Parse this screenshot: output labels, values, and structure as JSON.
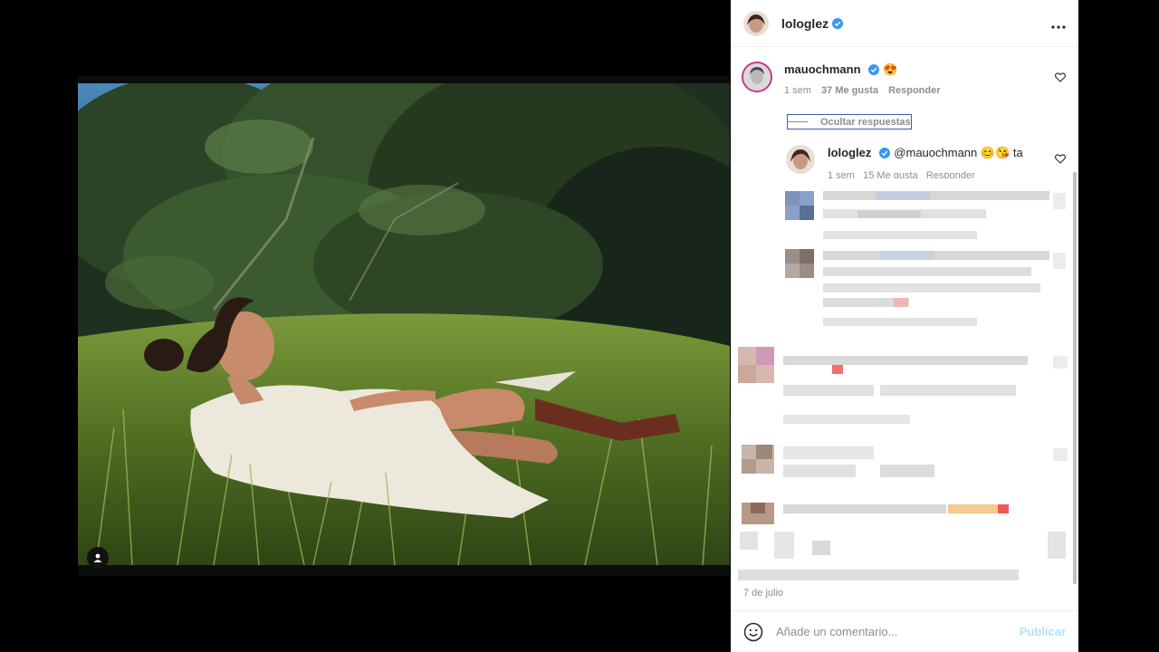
{
  "post": {
    "author": "lologlez",
    "verified": true,
    "more_icon": "more-horizontal-icon",
    "date": "7 de julio"
  },
  "comments": [
    {
      "user": "mauochmann",
      "verified": true,
      "text": "😍",
      "time": "1 sem",
      "likes": "37 Me gusta",
      "reply_label": "Responder",
      "hide_replies_label": "Ocultar respuestas"
    }
  ],
  "reply": {
    "user": "lologlez",
    "verified": true,
    "text": "@mauochmann 😊😘 ta",
    "meta_partial": "1 sem   15 Me gusta   Responder"
  },
  "composer": {
    "placeholder": "Añade un comentario...",
    "publish_label": "Publicar"
  },
  "colors": {
    "verified_blue": "#3897f0",
    "publish_disabled": "#b2dffc",
    "muted_text": "#8e8e8e"
  }
}
